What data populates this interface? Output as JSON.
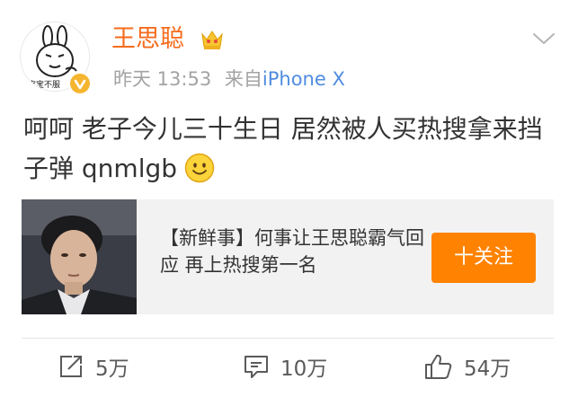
{
  "post": {
    "username": "王思聪",
    "time": "昨天 13:53",
    "source_prefix": "来自",
    "source": "iPhone X",
    "text": "呵呵 老子今儿三十生日 居然被人买热搜拿来挡子弹 qnmlgb",
    "avatar": {
      "caption": "宝宝不服"
    }
  },
  "card": {
    "title": "【新鲜事】何事让王思聪霸气回应 再上热搜第一名",
    "follow_label": "十关注"
  },
  "actions": {
    "repost_count": "5万",
    "comment_count": "10万",
    "like_count": "54万"
  },
  "icons": {
    "crown": "crown-icon",
    "verified": "verified-badge-icon",
    "chevron": "chevron-down-icon",
    "emoji": "smile-emoji-icon",
    "repost": "repost-icon",
    "comment": "comment-icon",
    "like": "thumbs-up-icon"
  },
  "colors": {
    "username": "#f56b1b",
    "source": "#4f8ce0",
    "meta": "#a3a3a3",
    "follow_button": "#ff8200",
    "card_background": "#f2f2f2"
  }
}
